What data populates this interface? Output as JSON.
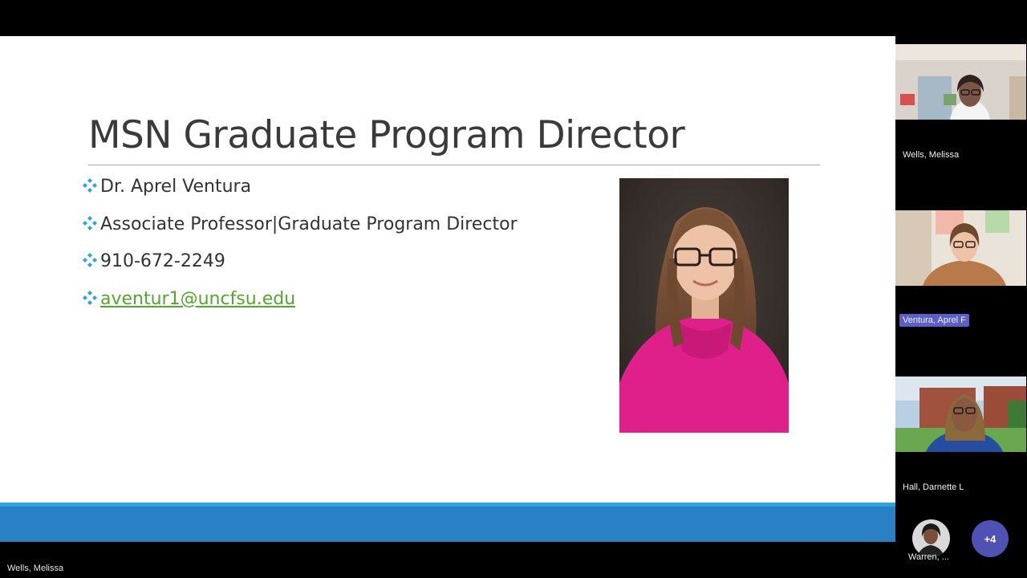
{
  "slide": {
    "title": "MSN Graduate Program Director",
    "bullets": [
      "Dr. Aprel Ventura",
      "Associate Professor|Graduate Program Director",
      "910-672-2249"
    ],
    "email": "aventur1@uncfsu.edu",
    "colors": {
      "bullet": "#2fa3dc",
      "link": "#56a533",
      "footer_stripe": "#2fa3dc",
      "footer_band": "#2a80c5",
      "sweater": "#e0208a"
    }
  },
  "speaker_label": "Wells, Melissa",
  "participants": [
    {
      "name": "Wells, Melissa",
      "active": false
    },
    {
      "name": "Ventura, Aprel F",
      "active": true
    },
    {
      "name": "Hall, Darnette L",
      "active": false
    }
  ],
  "overflow": {
    "name": "Warren, ...",
    "more_label": "+4"
  },
  "icons": {
    "bullet": "diamond-bullet-icon"
  }
}
